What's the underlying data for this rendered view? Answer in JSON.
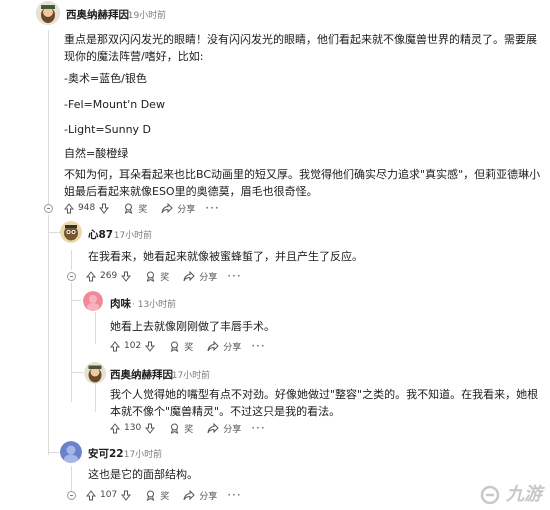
{
  "comments": [
    {
      "username": "西奥纳赫拜因",
      "time": "· 19小时前",
      "paragraphs": [
        "重点是那双闪闪发光的眼睛！没有闪闪发光的眼睛，他们看起来就不像魔兽世界的精灵了。需要展现你的魔法阵营/嗜好，比如:",
        "-奥术=蓝色/银色",
        "-Fel=Mount'n Dew",
        "-Light=Sunny D",
        "自然=酸橙绿",
        "不知为何，耳朵看起来也比BC动画里的短又厚。我觉得他们确实尽力追求\"真实感\"，但莉亚德琳小姐最后看起来就像ESO里的奥德莫，眉毛也很奇怪。"
      ],
      "votes": "948",
      "award": "奖",
      "share": "分享",
      "more": "···"
    },
    {
      "username": "心87",
      "time": "· 17小时前",
      "paragraphs": [
        "在我看来，她看起来就像被蜜蜂蜇了，并且产生了反应。"
      ],
      "votes": "269",
      "award": "奖",
      "share": "分享",
      "more": "···"
    },
    {
      "username": "肉味",
      "time": "· 13小时前",
      "paragraphs": [
        "她看上去就像刚刚做了丰唇手术。"
      ],
      "votes": "102",
      "award": "奖",
      "share": "分享",
      "more": "···"
    },
    {
      "username": "西奥纳赫拜因",
      "time": "· 17小时前",
      "paragraphs": [
        "我个人觉得她的嘴型有点不对劲。好像她做过\"整容\"之类的。我不知道。在我看来，她根本就不像个\"魔兽精灵\"。不过这只是我的看法。"
      ],
      "votes": "130",
      "award": "奖",
      "share": "分享",
      "more": "···"
    },
    {
      "username": "安可22",
      "time": "· 17小时前",
      "paragraphs": [
        "这也是它的面部结构。"
      ],
      "votes": "107",
      "award": "奖",
      "share": "分享",
      "more": "···"
    }
  ],
  "watermark": "九游",
  "colors": {
    "text": "#1c1c1c",
    "meta": "#7c7c7c",
    "thread_line": "#dcdcdc",
    "avatar_pink": "#f08a9a",
    "avatar_blue": "#6b82c9"
  }
}
